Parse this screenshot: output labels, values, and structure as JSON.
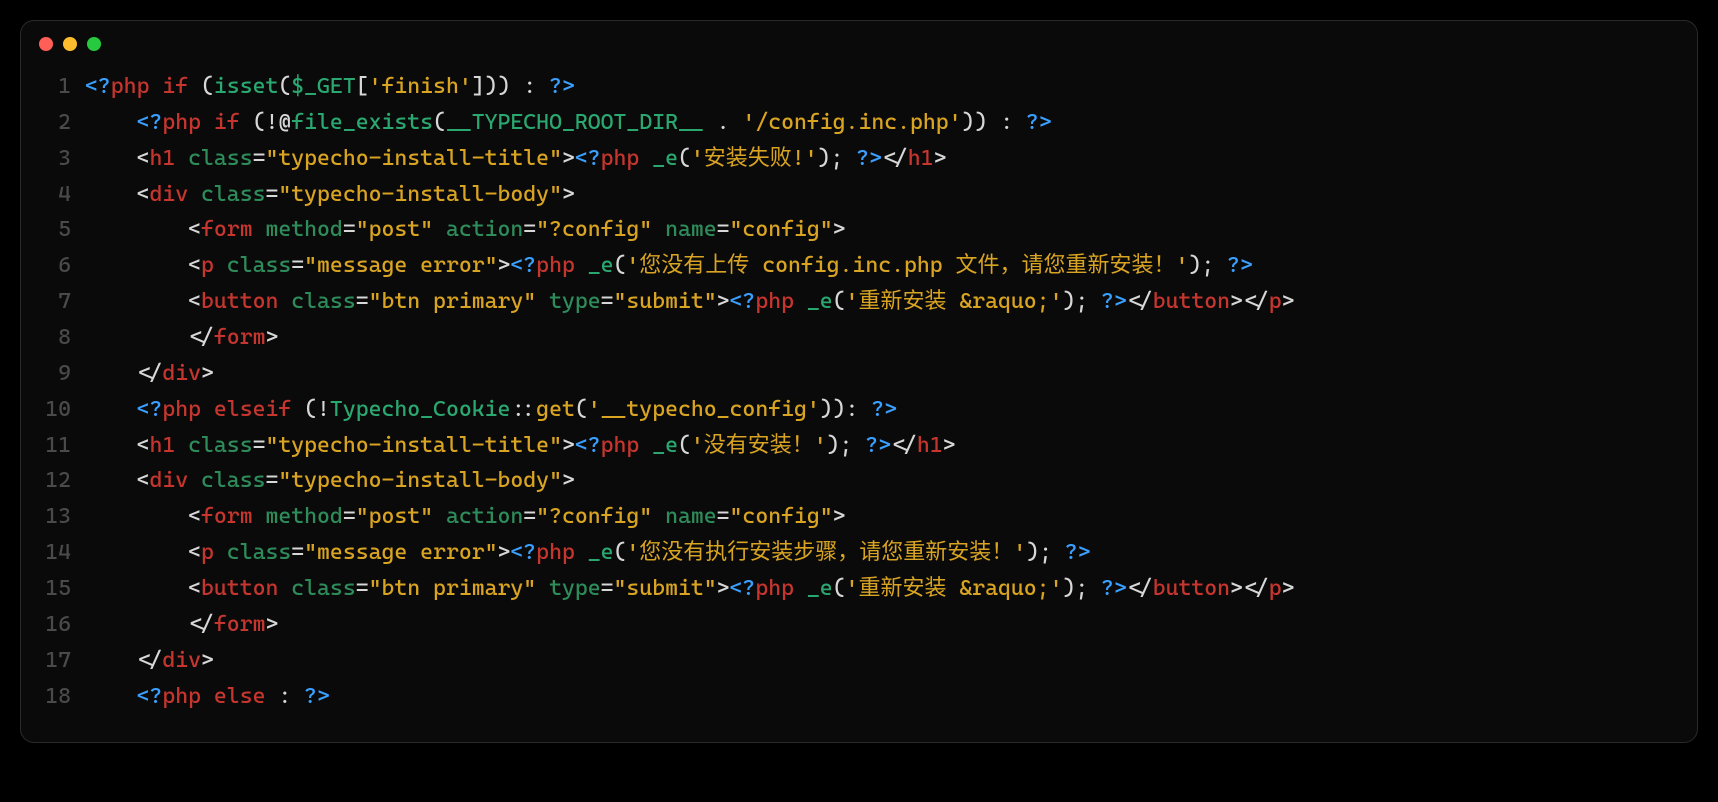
{
  "window": {
    "buttons": {
      "close": "close",
      "min": "minimize",
      "max": "maximize"
    }
  },
  "editor": {
    "lineNumbers": [
      "1",
      "2",
      "3",
      "4",
      "5",
      "6",
      "7",
      "8",
      "9",
      "10",
      "11",
      "12",
      "13",
      "14",
      "15",
      "16",
      "17",
      "18"
    ],
    "lines": [
      [
        {
          "t": "<?",
          "c": "pi"
        },
        {
          "t": "php",
          "c": "kw"
        },
        {
          "t": " ",
          "c": "punc"
        },
        {
          "t": "if",
          "c": "kw"
        },
        {
          "t": " (",
          "c": "punc"
        },
        {
          "t": "isset",
          "c": "fn"
        },
        {
          "t": "(",
          "c": "punc"
        },
        {
          "t": "$_GET",
          "c": "fn"
        },
        {
          "t": "[",
          "c": "punc"
        },
        {
          "t": "'finish'",
          "c": "lit"
        },
        {
          "t": "])) : ",
          "c": "punc"
        },
        {
          "t": "?>",
          "c": "pi"
        }
      ],
      [
        {
          "t": "    ",
          "c": "punc"
        },
        {
          "t": "<?",
          "c": "pi"
        },
        {
          "t": "php",
          "c": "kw"
        },
        {
          "t": " ",
          "c": "punc"
        },
        {
          "t": "if",
          "c": "kw"
        },
        {
          "t": " (!@",
          "c": "punc"
        },
        {
          "t": "file_exists",
          "c": "fn"
        },
        {
          "t": "(",
          "c": "punc"
        },
        {
          "t": "__TYPECHO_ROOT_DIR__",
          "c": "cls"
        },
        {
          "t": " . ",
          "c": "punc"
        },
        {
          "t": "'/config.inc.php'",
          "c": "lit"
        },
        {
          "t": ")) : ",
          "c": "punc"
        },
        {
          "t": "?>",
          "c": "pi"
        }
      ],
      [
        {
          "t": "    <",
          "c": "punc"
        },
        {
          "t": "h1",
          "c": "kw"
        },
        {
          "t": " ",
          "c": "punc"
        },
        {
          "t": "class",
          "c": "attr"
        },
        {
          "t": "=",
          "c": "punc"
        },
        {
          "t": "\"typecho-install-title\"",
          "c": "lit"
        },
        {
          "t": ">",
          "c": "punc"
        },
        {
          "t": "<?",
          "c": "pi"
        },
        {
          "t": "php",
          "c": "kw"
        },
        {
          "t": " ",
          "c": "punc"
        },
        {
          "t": "_e",
          "c": "fn"
        },
        {
          "t": "(",
          "c": "punc"
        },
        {
          "t": "'安装失败!'",
          "c": "lit"
        },
        {
          "t": "); ",
          "c": "punc"
        },
        {
          "t": "?>",
          "c": "pi"
        },
        {
          "t": "</",
          "c": "punc"
        },
        {
          "t": "h1",
          "c": "kw"
        },
        {
          "t": ">",
          "c": "punc"
        }
      ],
      [
        {
          "t": "    <",
          "c": "punc"
        },
        {
          "t": "div",
          "c": "kw"
        },
        {
          "t": " ",
          "c": "punc"
        },
        {
          "t": "class",
          "c": "attr"
        },
        {
          "t": "=",
          "c": "punc"
        },
        {
          "t": "\"typecho-install-body\"",
          "c": "lit"
        },
        {
          "t": ">",
          "c": "punc"
        }
      ],
      [
        {
          "t": "        <",
          "c": "punc"
        },
        {
          "t": "form",
          "c": "kw"
        },
        {
          "t": " ",
          "c": "punc"
        },
        {
          "t": "method",
          "c": "attr"
        },
        {
          "t": "=",
          "c": "punc"
        },
        {
          "t": "\"post\"",
          "c": "lit"
        },
        {
          "t": " ",
          "c": "punc"
        },
        {
          "t": "action",
          "c": "attr"
        },
        {
          "t": "=",
          "c": "punc"
        },
        {
          "t": "\"?config\"",
          "c": "lit"
        },
        {
          "t": " ",
          "c": "punc"
        },
        {
          "t": "name",
          "c": "attr"
        },
        {
          "t": "=",
          "c": "punc"
        },
        {
          "t": "\"config\"",
          "c": "lit"
        },
        {
          "t": ">",
          "c": "punc"
        }
      ],
      [
        {
          "t": "        <",
          "c": "punc"
        },
        {
          "t": "p",
          "c": "kw"
        },
        {
          "t": " ",
          "c": "punc"
        },
        {
          "t": "class",
          "c": "attr"
        },
        {
          "t": "=",
          "c": "punc"
        },
        {
          "t": "\"message error\"",
          "c": "lit"
        },
        {
          "t": ">",
          "c": "punc"
        },
        {
          "t": "<?",
          "c": "pi"
        },
        {
          "t": "php",
          "c": "kw"
        },
        {
          "t": " ",
          "c": "punc"
        },
        {
          "t": "_e",
          "c": "fn"
        },
        {
          "t": "(",
          "c": "punc"
        },
        {
          "t": "'您没有上传 config.inc.php 文件，请您重新安装！'",
          "c": "lit"
        },
        {
          "t": "); ",
          "c": "punc"
        },
        {
          "t": "?>",
          "c": "pi"
        }
      ],
      [
        {
          "t": "        <",
          "c": "punc"
        },
        {
          "t": "button",
          "c": "kw"
        },
        {
          "t": " ",
          "c": "punc"
        },
        {
          "t": "class",
          "c": "attr"
        },
        {
          "t": "=",
          "c": "punc"
        },
        {
          "t": "\"btn primary\"",
          "c": "lit"
        },
        {
          "t": " ",
          "c": "punc"
        },
        {
          "t": "type",
          "c": "attr"
        },
        {
          "t": "=",
          "c": "punc"
        },
        {
          "t": "\"submit\"",
          "c": "lit"
        },
        {
          "t": ">",
          "c": "punc"
        },
        {
          "t": "<?",
          "c": "pi"
        },
        {
          "t": "php",
          "c": "kw"
        },
        {
          "t": " ",
          "c": "punc"
        },
        {
          "t": "_e",
          "c": "fn"
        },
        {
          "t": "(",
          "c": "punc"
        },
        {
          "t": "'重新安装 &raquo;'",
          "c": "lit"
        },
        {
          "t": "); ",
          "c": "punc"
        },
        {
          "t": "?>",
          "c": "pi"
        },
        {
          "t": "</",
          "c": "punc"
        },
        {
          "t": "button",
          "c": "kw"
        },
        {
          "t": ">",
          "c": "punc"
        },
        {
          "t": "</",
          "c": "punc"
        },
        {
          "t": "p",
          "c": "kw"
        },
        {
          "t": ">",
          "c": "punc"
        }
      ],
      [
        {
          "t": "        </",
          "c": "punc"
        },
        {
          "t": "form",
          "c": "kw"
        },
        {
          "t": ">",
          "c": "punc"
        }
      ],
      [
        {
          "t": "    </",
          "c": "punc"
        },
        {
          "t": "div",
          "c": "kw"
        },
        {
          "t": ">",
          "c": "punc"
        }
      ],
      [
        {
          "t": "    ",
          "c": "punc"
        },
        {
          "t": "<?",
          "c": "pi"
        },
        {
          "t": "php",
          "c": "kw"
        },
        {
          "t": " ",
          "c": "punc"
        },
        {
          "t": "elseif",
          "c": "kw"
        },
        {
          "t": " (!",
          "c": "punc"
        },
        {
          "t": "Typecho_Cookie",
          "c": "cls"
        },
        {
          "t": "::",
          "c": "punc"
        },
        {
          "t": "get",
          "c": "sta"
        },
        {
          "t": "(",
          "c": "punc"
        },
        {
          "t": "'__typecho_config'",
          "c": "lit"
        },
        {
          "t": ")): ",
          "c": "punc"
        },
        {
          "t": "?>",
          "c": "pi"
        }
      ],
      [
        {
          "t": "    <",
          "c": "punc"
        },
        {
          "t": "h1",
          "c": "kw"
        },
        {
          "t": " ",
          "c": "punc"
        },
        {
          "t": "class",
          "c": "attr"
        },
        {
          "t": "=",
          "c": "punc"
        },
        {
          "t": "\"typecho-install-title\"",
          "c": "lit"
        },
        {
          "t": ">",
          "c": "punc"
        },
        {
          "t": "<?",
          "c": "pi"
        },
        {
          "t": "php",
          "c": "kw"
        },
        {
          "t": " ",
          "c": "punc"
        },
        {
          "t": "_e",
          "c": "fn"
        },
        {
          "t": "(",
          "c": "punc"
        },
        {
          "t": "'没有安装！'",
          "c": "lit"
        },
        {
          "t": "); ",
          "c": "punc"
        },
        {
          "t": "?>",
          "c": "pi"
        },
        {
          "t": "</",
          "c": "punc"
        },
        {
          "t": "h1",
          "c": "kw"
        },
        {
          "t": ">",
          "c": "punc"
        }
      ],
      [
        {
          "t": "    <",
          "c": "punc"
        },
        {
          "t": "div",
          "c": "kw"
        },
        {
          "t": " ",
          "c": "punc"
        },
        {
          "t": "class",
          "c": "attr"
        },
        {
          "t": "=",
          "c": "punc"
        },
        {
          "t": "\"typecho-install-body\"",
          "c": "lit"
        },
        {
          "t": ">",
          "c": "punc"
        }
      ],
      [
        {
          "t": "        <",
          "c": "punc"
        },
        {
          "t": "form",
          "c": "kw"
        },
        {
          "t": " ",
          "c": "punc"
        },
        {
          "t": "method",
          "c": "attr"
        },
        {
          "t": "=",
          "c": "punc"
        },
        {
          "t": "\"post\"",
          "c": "lit"
        },
        {
          "t": " ",
          "c": "punc"
        },
        {
          "t": "action",
          "c": "attr"
        },
        {
          "t": "=",
          "c": "punc"
        },
        {
          "t": "\"?config\"",
          "c": "lit"
        },
        {
          "t": " ",
          "c": "punc"
        },
        {
          "t": "name",
          "c": "attr"
        },
        {
          "t": "=",
          "c": "punc"
        },
        {
          "t": "\"config\"",
          "c": "lit"
        },
        {
          "t": ">",
          "c": "punc"
        }
      ],
      [
        {
          "t": "        <",
          "c": "punc"
        },
        {
          "t": "p",
          "c": "kw"
        },
        {
          "t": " ",
          "c": "punc"
        },
        {
          "t": "class",
          "c": "attr"
        },
        {
          "t": "=",
          "c": "punc"
        },
        {
          "t": "\"message error\"",
          "c": "lit"
        },
        {
          "t": ">",
          "c": "punc"
        },
        {
          "t": "<?",
          "c": "pi"
        },
        {
          "t": "php",
          "c": "kw"
        },
        {
          "t": " ",
          "c": "punc"
        },
        {
          "t": "_e",
          "c": "fn"
        },
        {
          "t": "(",
          "c": "punc"
        },
        {
          "t": "'您没有执行安装步骤，请您重新安装！'",
          "c": "lit"
        },
        {
          "t": "); ",
          "c": "punc"
        },
        {
          "t": "?>",
          "c": "pi"
        }
      ],
      [
        {
          "t": "        <",
          "c": "punc"
        },
        {
          "t": "button",
          "c": "kw"
        },
        {
          "t": " ",
          "c": "punc"
        },
        {
          "t": "class",
          "c": "attr"
        },
        {
          "t": "=",
          "c": "punc"
        },
        {
          "t": "\"btn primary\"",
          "c": "lit"
        },
        {
          "t": " ",
          "c": "punc"
        },
        {
          "t": "type",
          "c": "attr"
        },
        {
          "t": "=",
          "c": "punc"
        },
        {
          "t": "\"submit\"",
          "c": "lit"
        },
        {
          "t": ">",
          "c": "punc"
        },
        {
          "t": "<?",
          "c": "pi"
        },
        {
          "t": "php",
          "c": "kw"
        },
        {
          "t": " ",
          "c": "punc"
        },
        {
          "t": "_e",
          "c": "fn"
        },
        {
          "t": "(",
          "c": "punc"
        },
        {
          "t": "'重新安装 &raquo;'",
          "c": "lit"
        },
        {
          "t": "); ",
          "c": "punc"
        },
        {
          "t": "?>",
          "c": "pi"
        },
        {
          "t": "</",
          "c": "punc"
        },
        {
          "t": "button",
          "c": "kw"
        },
        {
          "t": ">",
          "c": "punc"
        },
        {
          "t": "</",
          "c": "punc"
        },
        {
          "t": "p",
          "c": "kw"
        },
        {
          "t": ">",
          "c": "punc"
        }
      ],
      [
        {
          "t": "        </",
          "c": "punc"
        },
        {
          "t": "form",
          "c": "kw"
        },
        {
          "t": ">",
          "c": "punc"
        }
      ],
      [
        {
          "t": "    </",
          "c": "punc"
        },
        {
          "t": "div",
          "c": "kw"
        },
        {
          "t": ">",
          "c": "punc"
        }
      ],
      [
        {
          "t": "    ",
          "c": "punc"
        },
        {
          "t": "<?",
          "c": "pi"
        },
        {
          "t": "php",
          "c": "kw"
        },
        {
          "t": " ",
          "c": "punc"
        },
        {
          "t": "else",
          "c": "kw"
        },
        {
          "t": " : ",
          "c": "punc"
        },
        {
          "t": "?>",
          "c": "pi"
        }
      ]
    ]
  }
}
